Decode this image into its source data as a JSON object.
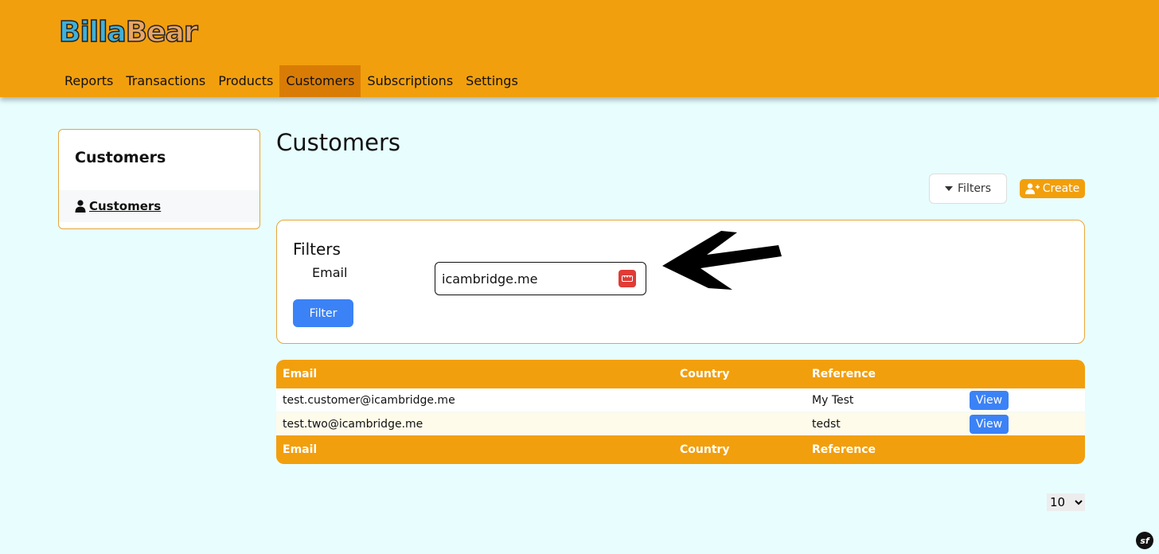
{
  "brand": {
    "logo_left": "Billa",
    "logo_right": "Bear"
  },
  "nav": {
    "items": [
      {
        "label": "Reports"
      },
      {
        "label": "Transactions"
      },
      {
        "label": "Products"
      },
      {
        "label": "Customers"
      },
      {
        "label": "Subscriptions"
      },
      {
        "label": "Settings"
      }
    ],
    "active": "Customers"
  },
  "sidebar": {
    "title": "Customers",
    "link": {
      "label": "Customers",
      "icon": "user-icon"
    }
  },
  "main": {
    "title": "Customers",
    "filters_button": "Filters",
    "create_button": "Create",
    "filter_panel": {
      "title": "Filters",
      "email_label": "Email",
      "email_value": "icambridge.me",
      "submit_label": "Filter"
    },
    "table": {
      "columns": [
        "Email",
        "Country",
        "Reference",
        ""
      ],
      "rows": [
        {
          "email": "test.customer@icambridge.me",
          "country": "",
          "reference": "My Test",
          "action": "View"
        },
        {
          "email": "test.two@icambridge.me",
          "country": "",
          "reference": "tedst",
          "action": "View"
        }
      ]
    },
    "per_page": "10"
  },
  "colors": {
    "accent": "#f29f0d",
    "background": "#e8fdfe",
    "primary_button": "#3b82f6",
    "active_nav": "#d97c06"
  }
}
